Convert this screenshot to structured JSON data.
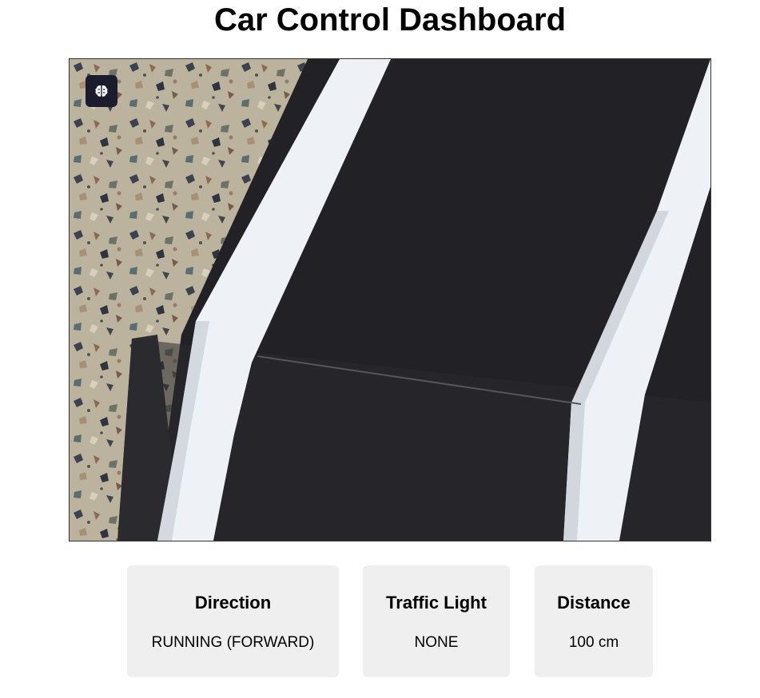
{
  "page": {
    "title": "Car Control Dashboard"
  },
  "camera": {
    "overlay_icon": "brain-icon",
    "colors": {
      "floor": "#b9b09a",
      "track": "#202023",
      "tape": "#f1f4f8",
      "frame_border": "#333333",
      "overlay_button": "#1b1c2e"
    }
  },
  "status_cards": [
    {
      "label": "Direction",
      "value": "RUNNING (FORWARD)"
    },
    {
      "label": "Traffic Light",
      "value": "NONE"
    },
    {
      "label": "Distance",
      "value": "100 cm"
    }
  ],
  "colors": {
    "card_background": "#efefef",
    "page_background": "#ffffff"
  }
}
